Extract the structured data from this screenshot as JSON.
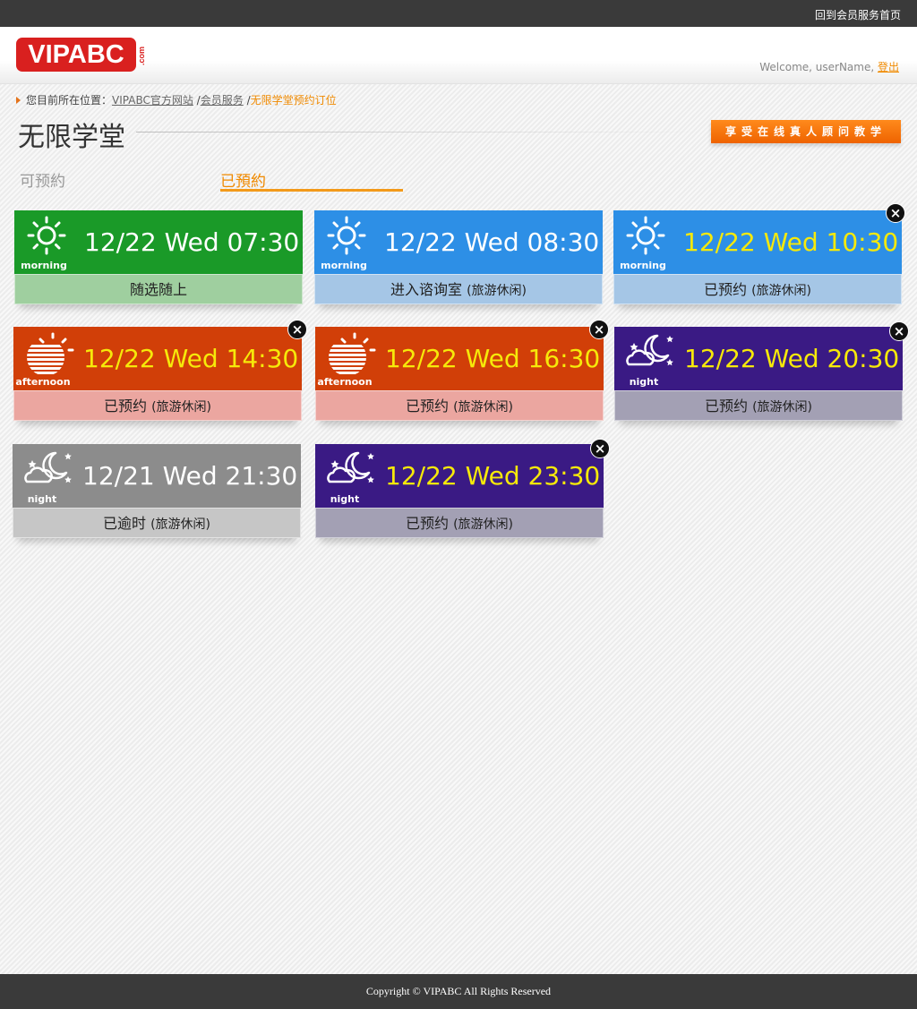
{
  "topbar": {
    "home_link": "回到会员服务首页"
  },
  "header": {
    "logo_text": "VIPABC",
    "logo_com": ".com",
    "welcome_text": "Welcome, userName, ",
    "logout_label": "登出"
  },
  "breadcrumb": {
    "prefix": "您目前所在位置：",
    "items": [
      "VIPABC官方网站",
      "会员服务"
    ],
    "separator": "/",
    "current": "无限学堂预约订位"
  },
  "page": {
    "title": "无限学堂",
    "promo_label": "享受在线真人顾问教学"
  },
  "tabs": [
    {
      "label": "可预約",
      "active": false
    },
    {
      "label": "已預約",
      "active": true
    }
  ],
  "cards": [
    {
      "period": "morning",
      "icon": "sun-icon",
      "time": "12/22 Wed 07:30",
      "status": "随选随上",
      "sub": "",
      "closable": false,
      "top_color": "#1a9a28",
      "bottom_color": "#9fcf9f",
      "time_color": "#ffffff"
    },
    {
      "period": "morning",
      "icon": "sun-icon",
      "time": "12/22 Wed 08:30",
      "status": "进入谘询室 ",
      "sub": "(旅游休闲)",
      "closable": false,
      "top_color": "#2d8fe6",
      "bottom_color": "#a5c6e6",
      "time_color": "#ffffff"
    },
    {
      "period": "morning",
      "icon": "sun-icon",
      "time": "12/22 Wed 10:30",
      "status": "已预约 ",
      "sub": "(旅游休闲)",
      "closable": true,
      "top_color": "#2d8fe6",
      "bottom_color": "#a5c6e6",
      "time_color": "#f6e90a"
    },
    {
      "period": "afternoon",
      "icon": "sunset-icon",
      "time": "12/22 Wed 14:30",
      "status": "已预约 ",
      "sub": "(旅游休闲)",
      "closable": true,
      "top_color": "#d13f08",
      "bottom_color": "#eba6a0",
      "time_color": "#f6e90a"
    },
    {
      "period": "afternoon",
      "icon": "sunset-icon",
      "time": "12/22 Wed 16:30",
      "status": "已预约 ",
      "sub": "(旅游休闲)",
      "closable": true,
      "top_color": "#d13f08",
      "bottom_color": "#eba6a0",
      "time_color": "#f6e90a"
    },
    {
      "period": "night",
      "icon": "moon-cloud-icon",
      "time": "12/22 Wed 20:30",
      "status": "已预约 ",
      "sub": "(旅游休闲)",
      "closable": true,
      "top_color": "#3a1a84",
      "bottom_color": "#a3a0b4",
      "time_color": "#f6e90a"
    },
    {
      "period": "night",
      "icon": "moon-cloud-icon",
      "time": "12/21 Wed 21:30",
      "status": "已逾时 ",
      "sub": "(旅游休闲)",
      "closable": false,
      "top_color": "#8c8c8c",
      "bottom_color": "#c6c6c6",
      "time_color": "#ffffff"
    },
    {
      "period": "night",
      "icon": "moon-cloud-icon",
      "time": "12/22 Wed 23:30",
      "status": "已预约 ",
      "sub": "(旅游休闲)",
      "closable": true,
      "top_color": "#3a1a84",
      "bottom_color": "#a3a0b4",
      "time_color": "#f6e90a"
    }
  ],
  "close_symbol": "×",
  "footer": {
    "copyright": "Copyright © VIPABC All Rights Reserved"
  }
}
